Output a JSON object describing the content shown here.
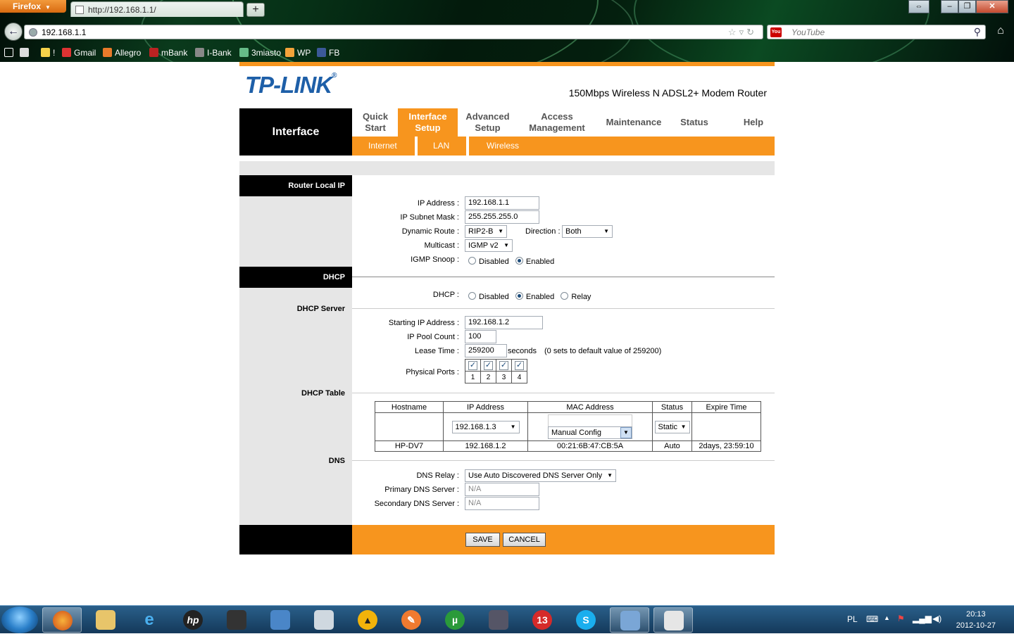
{
  "browser": {
    "menu_label": "Firefox",
    "tab_title": "http://192.168.1.1/",
    "new_tab": "+",
    "url": "192.168.1.1",
    "search_placeholder": "YouTube",
    "bookmarks": [
      "!",
      "Gmail",
      "Allegro",
      "mBank",
      "I-Bank",
      "3miasto",
      "WP",
      "FB"
    ]
  },
  "header": {
    "logo": "TP-LINK",
    "logo_mark": "®",
    "model": "150Mbps Wireless N ADSL2+ Modem Router",
    "section": "Interface"
  },
  "nav": {
    "items": [
      {
        "label": "Quick Start"
      },
      {
        "label": "Interface Setup"
      },
      {
        "label": "Advanced Setup"
      },
      {
        "label": "Access Management"
      },
      {
        "label": "Maintenance"
      },
      {
        "label": "Status"
      },
      {
        "label": "Help"
      }
    ],
    "sub": [
      "Internet",
      "LAN",
      "Wireless"
    ]
  },
  "router_local_ip": {
    "title": "Router Local IP",
    "ip_label": "IP Address :",
    "ip": "192.168.1.1",
    "mask_label": "IP Subnet Mask :",
    "mask": "255.255.255.0",
    "route_label": "Dynamic Route :",
    "route": "RIP2-B",
    "direction_label": "Direction :",
    "direction": "Both",
    "multicast_label": "Multicast :",
    "multicast": "IGMP v2",
    "igmp_label": "IGMP Snoop :",
    "disabled": "Disabled",
    "enabled": "Enabled"
  },
  "dhcp": {
    "title": "DHCP",
    "dhcp_label": "DHCP :",
    "disabled": "Disabled",
    "enabled": "Enabled",
    "relay": "Relay",
    "server_title": "DHCP Server",
    "start_label": "Starting IP Address :",
    "start": "192.168.1.2",
    "pool_label": "IP Pool Count :",
    "pool": "100",
    "lease_label": "Lease Time :",
    "lease": "259200",
    "lease_unit": "seconds",
    "lease_note": "(0 sets to default value of 259200)",
    "ports_label": "Physical Ports :",
    "ports": [
      "1",
      "2",
      "3",
      "4"
    ],
    "table_title": "DHCP Table",
    "columns": [
      "Hostname",
      "IP Address",
      "MAC Address",
      "Status",
      "Expire Time"
    ],
    "edit_ip": "192.168.1.3",
    "edit_mac": "Manual Config",
    "edit_status": "Static",
    "rows": [
      {
        "host": "HP-DV7",
        "ip": "192.168.1.2",
        "mac": "00:21:6B:47:CB:5A",
        "status": "Auto",
        "expire": "2days, 23:59:10"
      }
    ]
  },
  "dns": {
    "title": "DNS",
    "relay_label": "DNS Relay :",
    "relay": "Use Auto Discovered DNS Server Only",
    "primary_label": "Primary DNS Server :",
    "primary": "N/A",
    "secondary_label": "Secondary DNS Server :",
    "secondary": "N/A"
  },
  "buttons": {
    "save": "SAVE",
    "cancel": "CANCEL"
  },
  "taskbar": {
    "lang": "PL",
    "time": "20:13",
    "date": "2012-10-27"
  },
  "colors": {
    "accent": "#f7951e",
    "logo": "#1e5fa8"
  }
}
